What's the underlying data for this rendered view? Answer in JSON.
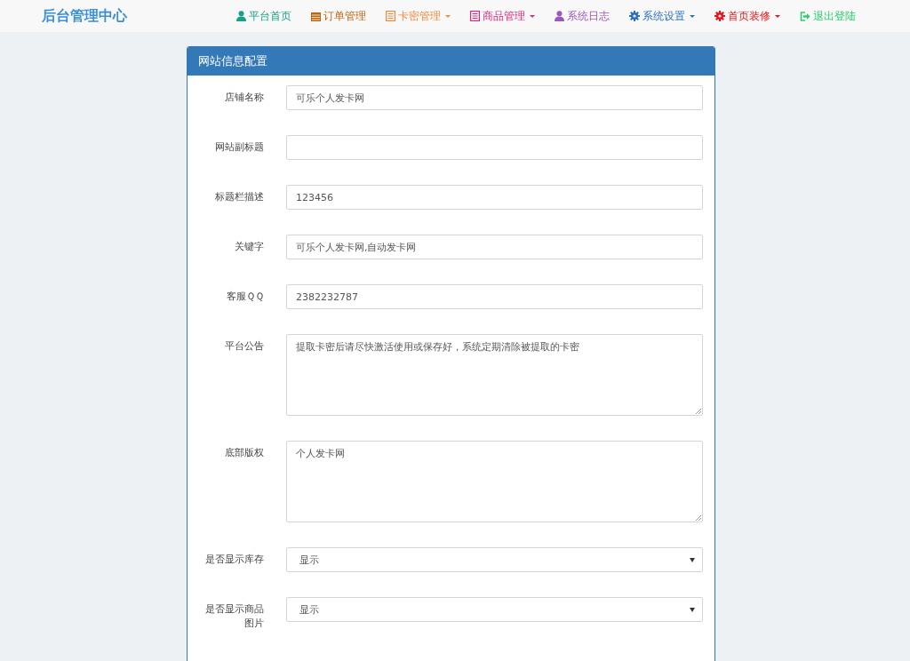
{
  "brand": "后台管理中心",
  "nav": [
    {
      "label": "平台首页",
      "kind": "user",
      "color": "#16a085",
      "dropdown": false
    },
    {
      "label": "订单管理",
      "kind": "calendar",
      "color": "#c0650f",
      "dropdown": false
    },
    {
      "label": "卡密管理",
      "kind": "list",
      "color": "#f08a3c",
      "dropdown": true
    },
    {
      "label": "商品管理",
      "kind": "list",
      "color": "#e0287d",
      "dropdown": true
    },
    {
      "label": "系统日志",
      "kind": "user",
      "color": "#9b59b6",
      "dropdown": false
    },
    {
      "label": "系统设置",
      "kind": "gear",
      "color": "#2a6fbf",
      "dropdown": true
    },
    {
      "label": "首页装修",
      "kind": "gear",
      "color": "#e6151b",
      "dropdown": true
    },
    {
      "label": "退出登陆",
      "kind": "logout",
      "color": "#2ecc71",
      "dropdown": false
    }
  ],
  "panel": {
    "title": "网站信息配置",
    "fields": [
      {
        "label": "店铺名称",
        "kind": "text",
        "value": "可乐个人发卡网"
      },
      {
        "label": "网站副标题",
        "kind": "text"
      },
      {
        "label": "标题栏描述",
        "kind": "text",
        "value": "123456"
      },
      {
        "label": "关键字",
        "kind": "text",
        "value": "可乐个人发卡网,自动发卡网"
      },
      {
        "label": "客服ＱＱ",
        "kind": "text",
        "value": "2382232787"
      },
      {
        "label": "平台公告",
        "kind": "textarea",
        "value": "提取卡密后请尽快激活使用或保存好，系统定期清除被提取的卡密"
      },
      {
        "label": "底部版权",
        "kind": "textarea",
        "value": "个人发卡网"
      },
      {
        "label": "是否显示库存",
        "kind": "select",
        "value": "显示"
      },
      {
        "label": "是否显示商品图片",
        "kind": "select",
        "value": "显示"
      }
    ]
  }
}
